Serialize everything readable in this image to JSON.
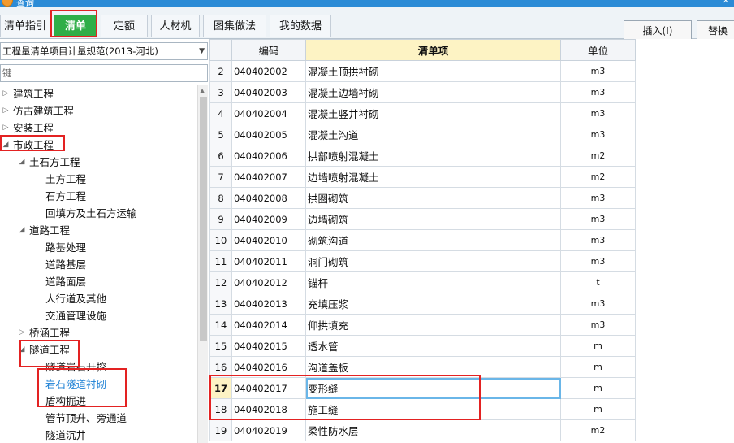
{
  "window": {
    "title": "查询"
  },
  "tabs": [
    {
      "label": "清单指引",
      "active": false
    },
    {
      "label": "清单",
      "active": true
    },
    {
      "label": "定额",
      "active": false
    },
    {
      "label": "人材机",
      "active": false
    },
    {
      "label": "图集做法",
      "active": false
    },
    {
      "label": "我的数据",
      "active": false
    }
  ],
  "toolbar": {
    "insert_label": "插入(I)",
    "replace_label": "替换"
  },
  "left_panel": {
    "spec_select": "工程量清单项目计量规范(2013-河北)",
    "search_placeholder": "键",
    "tree": [
      {
        "label": "建筑工程",
        "toggle": "▷"
      },
      {
        "label": "仿古建筑工程",
        "toggle": "▷"
      },
      {
        "label": "安装工程",
        "toggle": "▷"
      },
      {
        "label": "市政工程",
        "toggle": "◢"
      },
      {
        "label": "土石方工程",
        "toggle": "◢"
      },
      {
        "label": "土方工程",
        "toggle": ""
      },
      {
        "label": "石方工程",
        "toggle": ""
      },
      {
        "label": "回填方及土石方运输",
        "toggle": ""
      },
      {
        "label": "道路工程",
        "toggle": "◢"
      },
      {
        "label": "路基处理",
        "toggle": ""
      },
      {
        "label": "道路基层",
        "toggle": ""
      },
      {
        "label": "道路面层",
        "toggle": ""
      },
      {
        "label": "人行道及其他",
        "toggle": ""
      },
      {
        "label": "交通管理设施",
        "toggle": ""
      },
      {
        "label": "桥涵工程",
        "toggle": "▷"
      },
      {
        "label": "隧道工程",
        "toggle": "◢"
      },
      {
        "label": "隧道岩石开挖",
        "toggle": ""
      },
      {
        "label": "岩石隧道衬砌",
        "toggle": ""
      },
      {
        "label": "盾构掘进",
        "toggle": ""
      },
      {
        "label": "管节顶升、旁通道",
        "toggle": ""
      },
      {
        "label": "隧道沉井",
        "toggle": ""
      }
    ]
  },
  "table": {
    "columns": [
      "",
      "编码",
      "清单项",
      "单位"
    ],
    "rows": [
      {
        "num": "2",
        "code": "040402002",
        "name": "混凝土顶拱衬砌",
        "unit": "m3"
      },
      {
        "num": "3",
        "code": "040402003",
        "name": "混凝土边墙衬砌",
        "unit": "m3"
      },
      {
        "num": "4",
        "code": "040402004",
        "name": "混凝土竖井衬砌",
        "unit": "m3"
      },
      {
        "num": "5",
        "code": "040402005",
        "name": "混凝土沟道",
        "unit": "m3"
      },
      {
        "num": "6",
        "code": "040402006",
        "name": "拱部喷射混凝土",
        "unit": "m2"
      },
      {
        "num": "7",
        "code": "040402007",
        "name": "边墙喷射混凝土",
        "unit": "m2"
      },
      {
        "num": "8",
        "code": "040402008",
        "name": "拱圈砌筑",
        "unit": "m3"
      },
      {
        "num": "9",
        "code": "040402009",
        "name": "边墙砌筑",
        "unit": "m3"
      },
      {
        "num": "10",
        "code": "040402010",
        "name": "砌筑沟道",
        "unit": "m3"
      },
      {
        "num": "11",
        "code": "040402011",
        "name": "洞门砌筑",
        "unit": "m3"
      },
      {
        "num": "12",
        "code": "040402012",
        "name": "锚杆",
        "unit": "t"
      },
      {
        "num": "13",
        "code": "040402013",
        "name": "充填压浆",
        "unit": "m3"
      },
      {
        "num": "14",
        "code": "040402014",
        "name": "仰拱填充",
        "unit": "m3"
      },
      {
        "num": "15",
        "code": "040402015",
        "name": "透水管",
        "unit": "m"
      },
      {
        "num": "16",
        "code": "040402016",
        "name": "沟道盖板",
        "unit": "m"
      },
      {
        "num": "17",
        "code": "040402017",
        "name": "变形缝",
        "unit": "m"
      },
      {
        "num": "18",
        "code": "040402018",
        "name": "施工缝",
        "unit": "m"
      },
      {
        "num": "19",
        "code": "040402019",
        "name": "柔性防水层",
        "unit": "m2"
      }
    ]
  }
}
